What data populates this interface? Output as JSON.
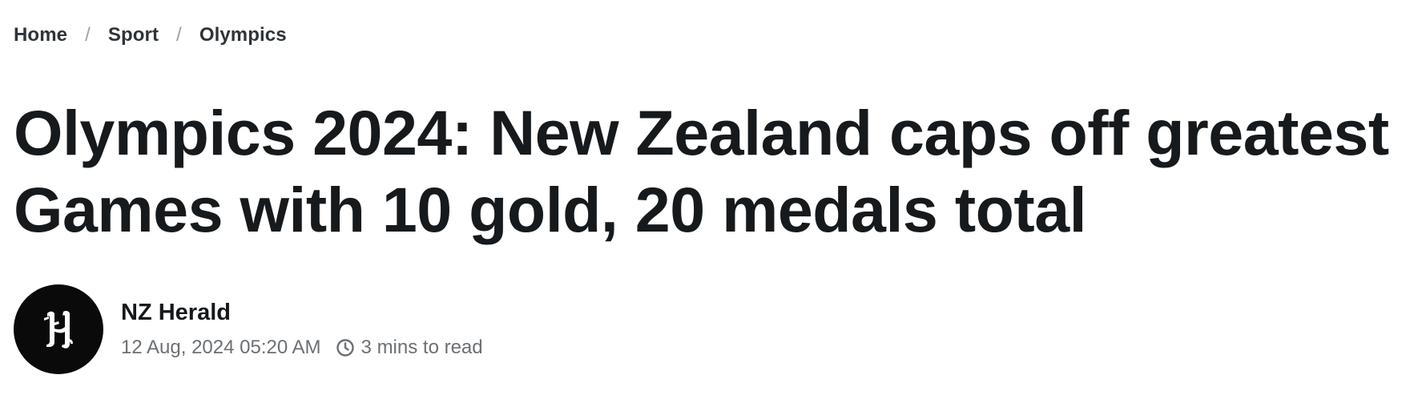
{
  "breadcrumb": {
    "items": [
      {
        "label": "Home"
      },
      {
        "label": "Sport"
      },
      {
        "label": "Olympics"
      }
    ],
    "separator": "/"
  },
  "article": {
    "title": "Olympics 2024: New Zealand caps off greatest Games with 10 gold, 20 medals total"
  },
  "byline": {
    "avatar_icon": "nz-herald-logo",
    "author": "NZ Herald",
    "date": "12 Aug, 2024 05:20 AM",
    "read_time_icon": "clock-icon",
    "read_time": "3 mins to read"
  },
  "colors": {
    "text_primary": "#171a1c",
    "text_muted": "#6b7075",
    "avatar_bg": "#0a0a0a",
    "background": "#ffffff"
  }
}
